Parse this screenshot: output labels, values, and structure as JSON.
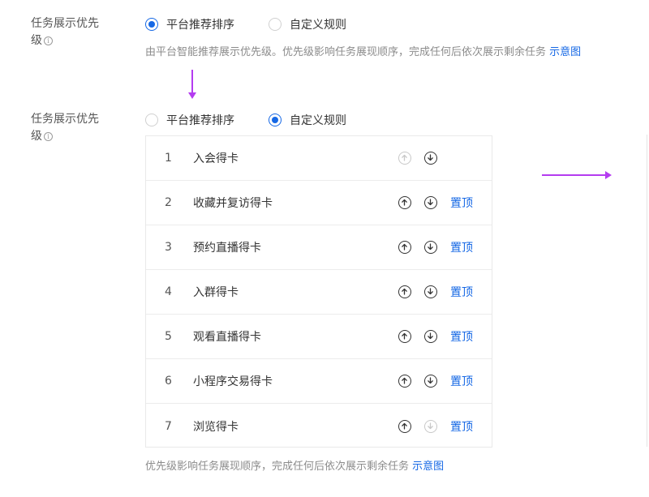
{
  "section1": {
    "label_line1": "任务展示优先",
    "label_line2": "级",
    "option_platform": "平台推荐排序",
    "option_custom": "自定义规则",
    "hint_text": "由平台智能推荐展示优先级。优先级影响任务展现顺序，完成任何后依次展示剩余任务",
    "hint_link": "示意图"
  },
  "section2": {
    "label_line1": "任务展示优先",
    "label_line2": "级",
    "option_platform": "平台推荐排序",
    "option_custom": "自定义规则",
    "pin_label": "置顶",
    "tasks": [
      {
        "index": "1",
        "name": "入会得卡"
      },
      {
        "index": "2",
        "name": "收藏并复访得卡"
      },
      {
        "index": "3",
        "name": "预约直播得卡"
      },
      {
        "index": "4",
        "name": "入群得卡"
      },
      {
        "index": "5",
        "name": "观看直播得卡"
      },
      {
        "index": "6",
        "name": "小程序交易得卡"
      },
      {
        "index": "7",
        "name": "浏览得卡"
      }
    ],
    "hint_text": "优先级影响任务展现顺序，完成任何后依次展示剩余任务",
    "hint_link": "示意图"
  },
  "colors": {
    "accent": "#1668e5",
    "annotation_arrow": "#b43cf0"
  }
}
